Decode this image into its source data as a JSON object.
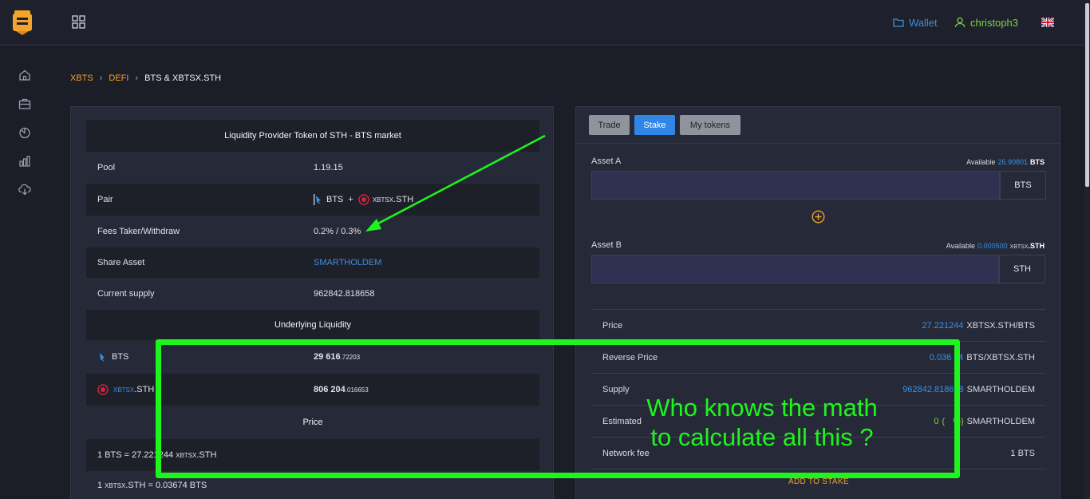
{
  "topbar": {
    "wallet_label": "Wallet",
    "username": "christoph3",
    "language": "en-GB"
  },
  "sidenav": {
    "items": [
      "home-icon",
      "briefcase-icon",
      "chart-pie-icon",
      "bar-chart-icon",
      "cloud-download-icon"
    ]
  },
  "breadcrumb": {
    "items": [
      "XBTS",
      "DEFI"
    ],
    "current": "BTS & XBTSX.STH"
  },
  "pool_info": {
    "title": "Liquidity Provider Token of STH - BTS market",
    "pool_label": "Pool",
    "pool_value": "1.19.15",
    "pair_label": "Pair",
    "pair_a": "BTS",
    "pair_plus": "+",
    "pair_b_prefix": "XBTSX",
    "pair_b": ".STH",
    "fees_label": "Fees Taker/Withdraw",
    "fees_value": "0.2% / 0.3%",
    "share_label": "Share Asset",
    "share_value": "SMARTHOLDEM",
    "supply_label": "Current supply",
    "supply_value": "962842.818658"
  },
  "underlying": {
    "title": "Underlying Liquidity",
    "bts_label": "BTS",
    "bts_value_int": "29 616",
    "bts_value_dec": ".72203",
    "sth_prefix": "XBTSX",
    "sth_label": ".STH",
    "sth_value_int": "806 204",
    "sth_value_dec": ".016653"
  },
  "price_section": {
    "title": "Price",
    "line1_prefix": "1 BTS = 27.221244",
    "line1_asset_prefix": "XBTSX",
    "line1_asset": ".STH",
    "line2_prefix": "1",
    "line2_asset_prefix": "XBTSX",
    "line2_asset": ".STH = 0.03674 BTS"
  },
  "tabs": [
    "Trade",
    "Stake",
    "My tokens"
  ],
  "stake": {
    "asset_a_label": "Asset A",
    "asset_a_avail_label": "Available",
    "asset_a_avail_value": "26.90801",
    "asset_a_avail_unit": "BTS",
    "asset_a_unit": "BTS",
    "asset_a_value": "",
    "asset_b_label": "Asset B",
    "asset_b_avail_label": "Available",
    "asset_b_avail_value": "0.000500",
    "asset_b_avail_prefix": "XBTSX",
    "asset_b_avail_unit": ".STH",
    "asset_b_unit": "STH",
    "asset_b_value": "",
    "rows": {
      "price_label": "Price",
      "price_value": "27.221244",
      "price_unit": "XBTSX.STH/BTS",
      "reverse_label": "Reverse Price",
      "reverse_value": "0.036",
      "reverse_tail": "4",
      "reverse_unit": "BTS/XBTSX.STH",
      "supply_label": "Supply",
      "supply_value": "962842.8186",
      "supply_tail": "8",
      "supply_unit": "SMARTHOLDEM",
      "estimated_label": "Estimated",
      "estimated_value": "0",
      "estimated_paren": "( ",
      "estimated_tail": "%)",
      "estimated_unit": "SMARTHOLDEM",
      "fee_label": "Network fee",
      "fee_value": "1 BTS"
    },
    "add_button": "ADD TO STAKE"
  },
  "annotation": {
    "line1": "Who knows the math",
    "line2": "to calculate all this ?",
    "color": "#1ef51e"
  },
  "colors": {
    "accent_orange": "#f2a12c",
    "accent_blue": "#3d8fe0",
    "accent_green": "#7ed14a"
  }
}
